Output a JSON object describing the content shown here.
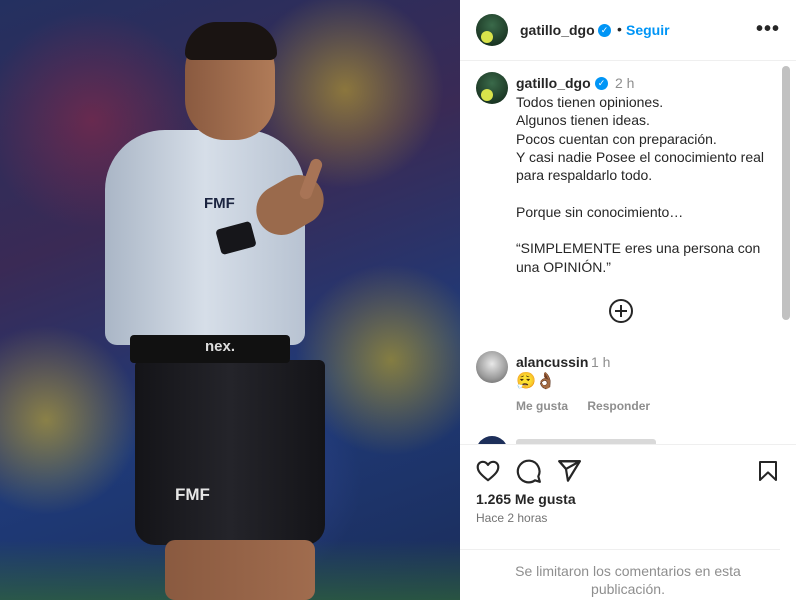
{
  "photo": {
    "chest_logo": "FMF",
    "belt_text": "nex.",
    "shorts_logo": "FMF"
  },
  "header": {
    "username": "gatillo_dgo",
    "separator": "•",
    "follow_label": "Seguir",
    "more_label": "•••"
  },
  "caption": {
    "username": "gatillo_dgo",
    "time": "2 h",
    "text": "Todos tienen opiniones.\nAlgunos tienen ideas.\nPocos cuentan con preparación.\nY casi nadie Posee el conocimiento real para respaldarlo todo.\n\nPorque sin conocimiento…\n\n“SIMPLEMENTE eres una persona con una OPINIÓN.”"
  },
  "comment": {
    "username": "alancussin",
    "time": "1 h",
    "text": "😮‍💨👌🏾",
    "like_label": "Me gusta",
    "reply_label": "Responder"
  },
  "footer": {
    "likes": "1.265 Me gusta",
    "posted": "Hace 2 horas",
    "limited": "Se limitaron los comentarios en esta publicación."
  },
  "icons": {
    "like": "heart-icon",
    "comment": "comment-icon",
    "share": "share-icon",
    "save": "bookmark-icon",
    "more": "more-icon",
    "verified": "verified-icon",
    "load_more": "plus-circle-icon"
  },
  "colors": {
    "accent": "#0095f6",
    "text": "#262626",
    "muted": "#8e8e8e"
  }
}
